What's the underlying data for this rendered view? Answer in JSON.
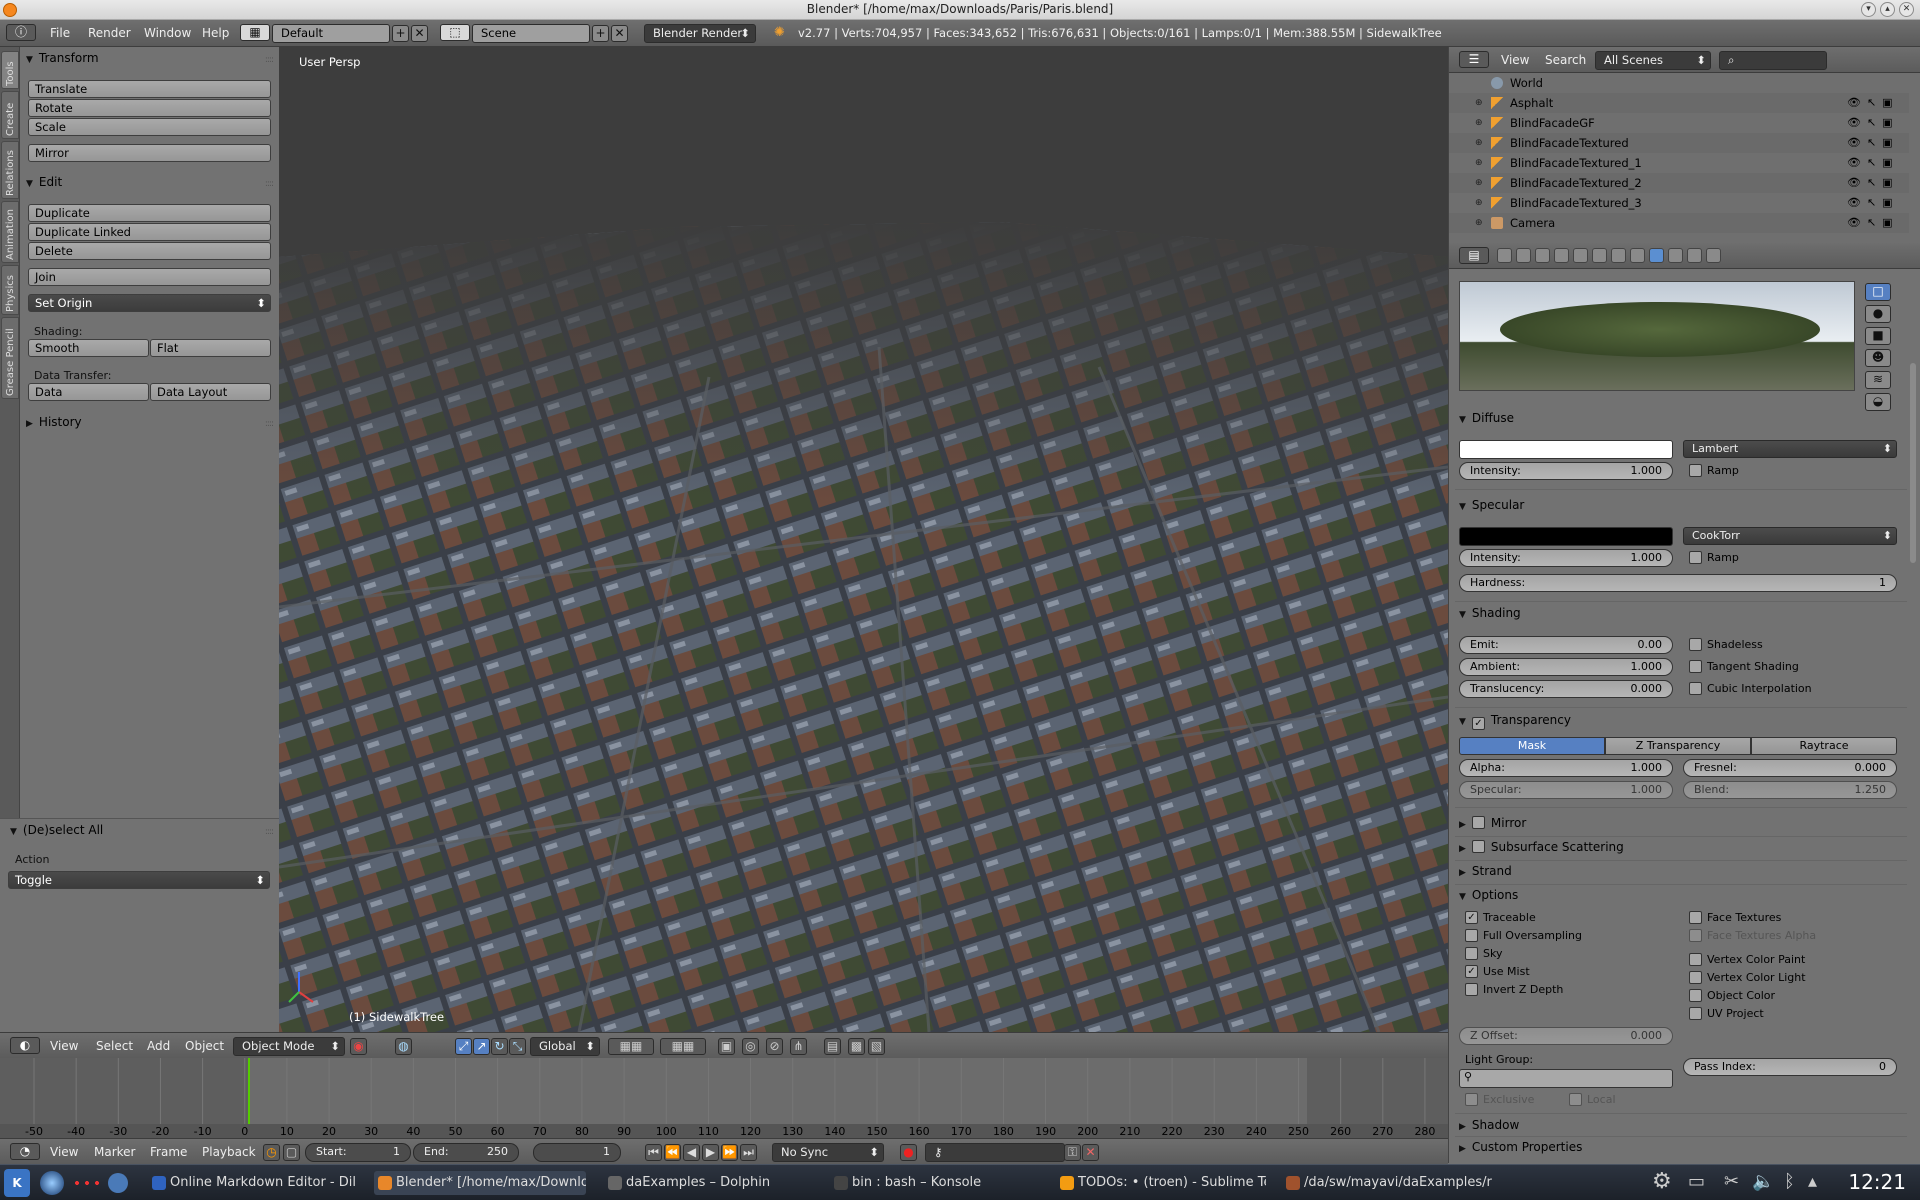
{
  "window": {
    "title": "Blender* [/home/max/Downloads/Paris/Paris.blend]"
  },
  "infobar": {
    "menus": [
      "File",
      "Render",
      "Window",
      "Help"
    ],
    "layout": "Default",
    "scene": "Scene",
    "engine": "Blender Render",
    "stats": "v2.77 | Verts:704,957 | Faces:343,652 | Tris:676,631 | Objects:0/161 | Lamps:0/1 | Mem:388.55M | SidewalkTree"
  },
  "tabs": [
    "Tools",
    "Create",
    "Relations",
    "Animation",
    "Physics",
    "Grease Pencil"
  ],
  "toolpanel": {
    "transform": {
      "title": "Transform",
      "buttons": [
        "Translate",
        "Rotate",
        "Scale",
        "Mirror"
      ]
    },
    "edit": {
      "title": "Edit",
      "buttons": [
        "Duplicate",
        "Duplicate Linked",
        "Delete",
        "Join"
      ],
      "set_origin": "Set Origin"
    },
    "shading": {
      "label": "Shading:",
      "smooth": "Smooth",
      "flat": "Flat"
    },
    "transfer": {
      "label": "Data Transfer:",
      "data": "Data",
      "layout": "Data Layout"
    },
    "history": "History"
  },
  "operator": {
    "title": "(De)select All",
    "action_label": "Action",
    "action_value": "Toggle"
  },
  "viewport": {
    "view_label": "User Persp",
    "object_label": "(1) SidewalkTree"
  },
  "vpheader": {
    "menus": [
      "View",
      "Select",
      "Add",
      "Object"
    ],
    "mode": "Object Mode",
    "orientation": "Global"
  },
  "timeline": {
    "ticks": [
      "-50",
      "-40",
      "-30",
      "-20",
      "-10",
      "0",
      "10",
      "20",
      "30",
      "40",
      "50",
      "60",
      "70",
      "80",
      "90",
      "100",
      "110",
      "120",
      "130",
      "140",
      "150",
      "160",
      "170",
      "180",
      "190",
      "200",
      "210",
      "220",
      "230",
      "240",
      "250",
      "260",
      "270",
      "280"
    ],
    "current_frame": 0
  },
  "tlheader": {
    "menus": [
      "View",
      "Marker",
      "Frame",
      "Playback"
    ],
    "start_label": "Start:",
    "start": "1",
    "end_label": "End:",
    "end": "250",
    "frame": "1",
    "sync": "No Sync"
  },
  "outliner": {
    "menus": [
      "View",
      "Search"
    ],
    "scenes": "All Scenes",
    "items": [
      "World",
      "Asphalt",
      "BlindFacadeGF",
      "BlindFacadeTextured",
      "BlindFacadeTextured_1",
      "BlindFacadeTextured_2",
      "BlindFacadeTextured_3",
      "Camera"
    ]
  },
  "material": {
    "diffuse": {
      "title": "Diffuse",
      "shader": "Lambert",
      "intensity_label": "Intensity:",
      "intensity": "1.000",
      "ramp": "Ramp"
    },
    "specular": {
      "title": "Specular",
      "shader": "CookTorr",
      "intensity_label": "Intensity:",
      "intensity": "1.000",
      "ramp": "Ramp",
      "hardness_label": "Hardness:",
      "hardness": "1"
    },
    "shading": {
      "title": "Shading",
      "emit_label": "Emit:",
      "emit": "0.00",
      "ambient_label": "Ambient:",
      "ambient": "1.000",
      "translucency_label": "Translucency:",
      "translucency": "0.000",
      "shadeless": "Shadeless",
      "tangent": "Tangent Shading",
      "cubic": "Cubic Interpolation"
    },
    "transparency": {
      "title": "Transparency",
      "modes": [
        "Mask",
        "Z Transparency",
        "Raytrace"
      ],
      "alpha_label": "Alpha:",
      "alpha": "1.000",
      "fresnel_label": "Fresnel:",
      "fresnel": "0.000",
      "specular_label": "Specular:",
      "specular": "1.000",
      "blend_label": "Blend:",
      "blend": "1.250"
    },
    "collapsed": [
      "Mirror",
      "Subsurface Scattering",
      "Strand"
    ],
    "options": {
      "title": "Options",
      "left": [
        "Traceable",
        "Full Oversampling",
        "Sky",
        "Use Mist",
        "Invert Z Depth"
      ],
      "left_checked": [
        true,
        false,
        false,
        true,
        false
      ],
      "right": [
        "Face Textures",
        "Face Textures Alpha",
        "Vertex Color Paint",
        "Vertex Color Light",
        "Object Color",
        "UV Project"
      ],
      "zoffset_label": "Z Offset:",
      "zoffset": "0.000",
      "lightgroup_label": "Light Group:",
      "passindex_label": "Pass Index:",
      "passindex": "0",
      "exclusive": "Exclusive",
      "local": "Local"
    },
    "bottom": [
      "Shadow",
      "Custom Properties"
    ]
  },
  "taskbar": {
    "tasks": [
      "Online Markdown Editor - Dillin",
      "Blender* [/home/max/Downloa",
      "daExamples – Dolphin",
      "bin : bash – Konsole",
      "TODOs: • (troen) - Sublime Te",
      "/da/sw/mayavi/daExamples/ru"
    ],
    "clock": "12:21"
  }
}
